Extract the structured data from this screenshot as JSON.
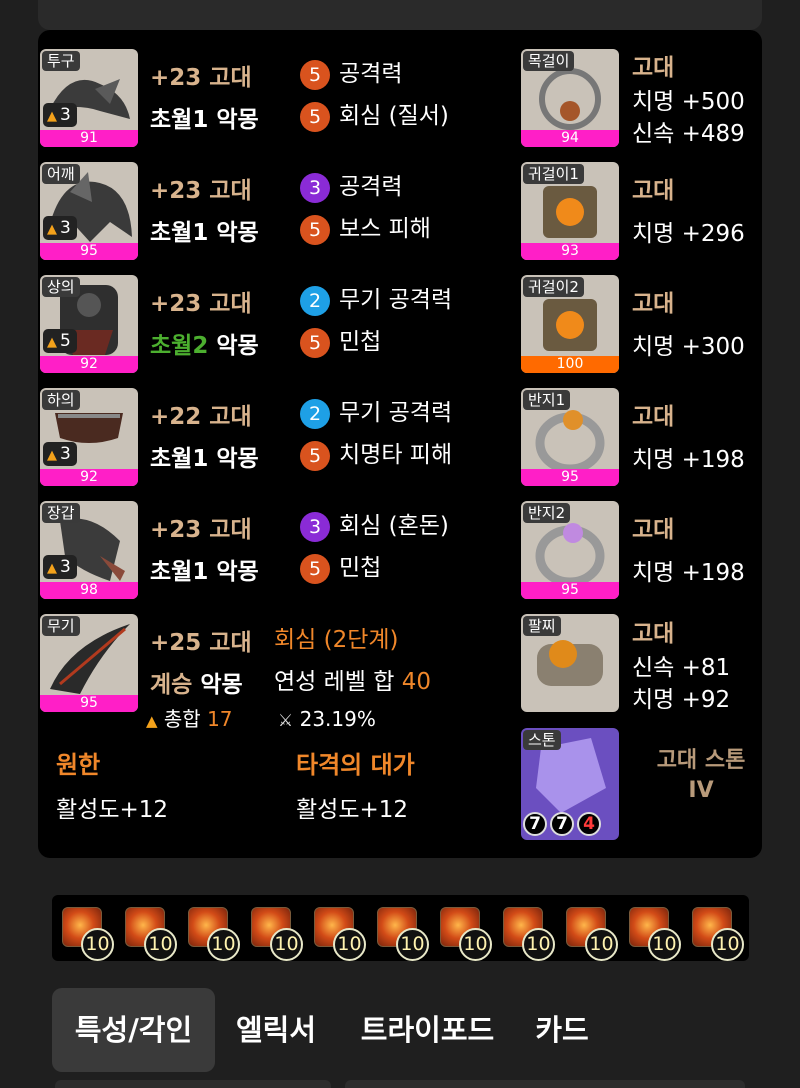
{
  "equipment": [
    {
      "slot": "투구",
      "tier": "3",
      "quality": "91",
      "upgrade": "+23 고대",
      "set_prefix": "초월1",
      "set_name": "악몽",
      "options": [
        {
          "level": "5",
          "color": "o",
          "text": "공격력"
        },
        {
          "level": "5",
          "color": "o",
          "text": "회심 (질서)"
        }
      ]
    },
    {
      "slot": "어깨",
      "tier": "3",
      "quality": "95",
      "upgrade": "+23 고대",
      "set_prefix": "초월1",
      "set_name": "악몽",
      "options": [
        {
          "level": "3",
          "color": "p",
          "text": "공격력"
        },
        {
          "level": "5",
          "color": "o",
          "text": "보스 피해"
        }
      ]
    },
    {
      "slot": "상의",
      "tier": "5",
      "quality": "92",
      "upgrade": "+23 고대",
      "set_prefix": "초월2",
      "set_name": "악몽",
      "options": [
        {
          "level": "2",
          "color": "b",
          "text": "무기 공격력"
        },
        {
          "level": "5",
          "color": "o",
          "text": "민첩"
        }
      ]
    },
    {
      "slot": "하의",
      "tier": "3",
      "quality": "92",
      "upgrade": "+22 고대",
      "set_prefix": "초월1",
      "set_name": "악몽",
      "options": [
        {
          "level": "2",
          "color": "b",
          "text": "무기 공격력"
        },
        {
          "level": "5",
          "color": "o",
          "text": "치명타 피해"
        }
      ]
    },
    {
      "slot": "장갑",
      "tier": "3",
      "quality": "98",
      "upgrade": "+23 고대",
      "set_prefix": "초월1",
      "set_name": "악몽",
      "options": [
        {
          "level": "3",
          "color": "p",
          "text": "회심 (혼돈)"
        },
        {
          "level": "5",
          "color": "o",
          "text": "민첩"
        }
      ]
    }
  ],
  "weapon": {
    "slot": "무기",
    "quality": "95",
    "upgrade": "+25 고대",
    "set_prefix": "계승",
    "set_name": "악몽",
    "elixir_title": "회심 (2단계)",
    "elixir_sum_label": "연성 레벨 합",
    "elixir_sum_value": "40",
    "total_label": "총합",
    "total_value": "17",
    "percent": "23.19%"
  },
  "accessories": [
    {
      "slot": "목걸이",
      "quality": "94",
      "grade": "고대",
      "stats": [
        "치명 +500",
        "신속 +489"
      ]
    },
    {
      "slot": "귀걸이1",
      "quality": "93",
      "grade": "고대",
      "stats": [
        "치명 +296"
      ]
    },
    {
      "slot": "귀걸이2",
      "quality": "100",
      "grade": "고대",
      "stats": [
        "치명 +300"
      ]
    },
    {
      "slot": "반지1",
      "quality": "95",
      "grade": "고대",
      "stats": [
        "치명 +198"
      ]
    },
    {
      "slot": "반지2",
      "quality": "95",
      "grade": "고대",
      "stats": [
        "치명 +198"
      ]
    },
    {
      "slot": "팔찌",
      "quality": "",
      "grade": "고대",
      "stats": [
        "신속 +81",
        "치명 +92"
      ]
    }
  ],
  "stone": {
    "slot": "스톤",
    "name_line1": "고대 스톤",
    "name_line2": "IV",
    "values": [
      "7",
      "7",
      "4"
    ]
  },
  "engravings": [
    {
      "title": "원한",
      "value": "활성도+12"
    },
    {
      "title": "타격의 대가",
      "value": "활성도+12"
    }
  ],
  "gems": [
    "10",
    "10",
    "10",
    "10",
    "10",
    "10",
    "10",
    "10",
    "10",
    "10",
    "10"
  ],
  "tabs": [
    "특성/각인",
    "엘릭서",
    "트라이포드",
    "카드"
  ],
  "active_tab": 0,
  "colors": {
    "quality_bar": "#ff1fc7",
    "quality_max": "#ff6a00",
    "upgrade_text": "#d8b38d",
    "orange_accent": "#f0872a",
    "panel_bg": "#000000"
  }
}
